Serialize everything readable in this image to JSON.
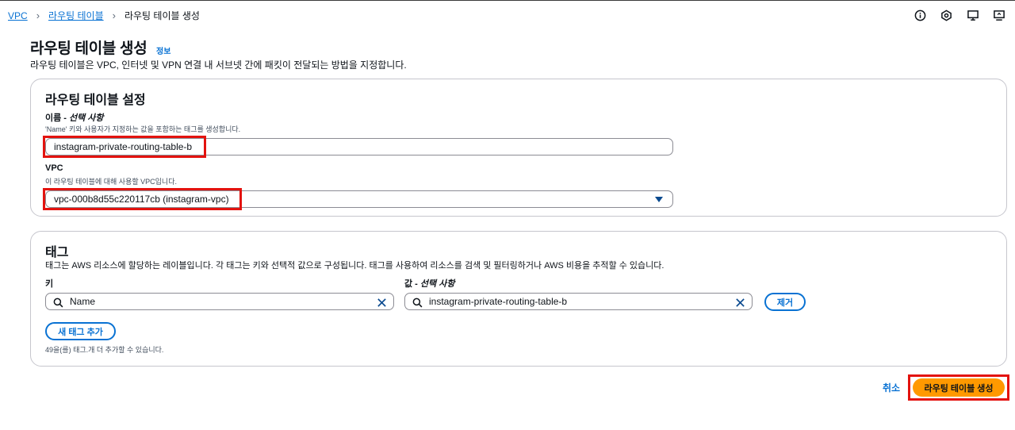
{
  "breadcrumb": {
    "items": [
      "VPC",
      "라우팅 테이블"
    ],
    "current": "라우팅 테이블 생성"
  },
  "header": {
    "title": "라우팅 테이블 생성",
    "info_link": "정보",
    "description": "라우팅 테이블은 VPC, 인터넷 및 VPN 연결 내 서브넷 간에 패킷이 전달되는 방법을 지정합니다."
  },
  "settings": {
    "heading": "라우팅 테이블 설정",
    "name_label": "이름 - ",
    "name_label_optional": "선택 사항",
    "name_hint": "'Name' 키와 사용자가 지정하는 값을 포함하는 태그를 생성합니다.",
    "name_value": "instagram-private-routing-table-b",
    "vpc_label": "VPC",
    "vpc_hint": "이 라우팅 테이블에 대해 사용할 VPC입니다.",
    "vpc_value": "vpc-000b8d55c220117cb (instagram-vpc)"
  },
  "tags": {
    "heading": "태그",
    "description": "태그는 AWS 리소스에 할당하는 레이블입니다. 각 태그는 키와 선택적 값으로 구성됩니다. 태그를 사용하여 리소스를 검색 및 필터링하거나 AWS 비용을 추적할 수 있습니다.",
    "key_label": "키",
    "value_label": "값 - ",
    "value_label_optional": "선택 사항",
    "key_value": "Name",
    "value_value": "instagram-private-routing-table-b",
    "remove_button": "제거",
    "add_button": "새 태그 추가",
    "remaining_note": "49을(를) 태그.개 더 추가할 수 있습니다."
  },
  "footer": {
    "cancel": "취소",
    "submit": "라우팅 테이블 생성"
  },
  "colors": {
    "link": "#0972d3",
    "primary": "#ff9900",
    "highlight": "#e3130f"
  }
}
